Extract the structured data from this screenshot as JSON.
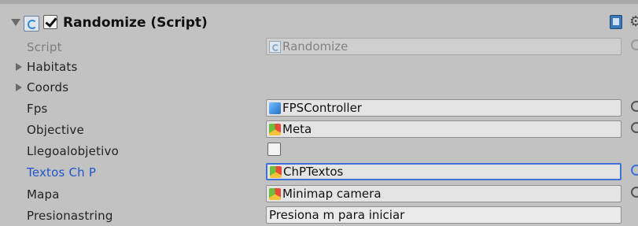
{
  "component": {
    "title": "Randomize (Script)",
    "enabled": true
  },
  "rows": {
    "script": {
      "label": "Script",
      "value": "Randomize",
      "icon": "script-icon"
    },
    "habitats": {
      "label": "Habitats"
    },
    "coords": {
      "label": "Coords"
    },
    "fps": {
      "label": "Fps",
      "value": "FPSController",
      "icon": "prefab-blue-cube-icon"
    },
    "objective": {
      "label": "Objective",
      "value": "Meta",
      "icon": "model-cube-icon"
    },
    "llegoalobjetivo": {
      "label": "Llegoalobjetivo",
      "checked": false
    },
    "textos": {
      "label": "Textos Ch P",
      "value": "ChPTextos",
      "icon": "model-cube-icon"
    },
    "mapa": {
      "label": "Mapa",
      "value": "Minimap camera",
      "icon": "model-cube-icon"
    },
    "presionastring": {
      "label": "Presionastring",
      "value": "Presiona m para iniciar"
    }
  },
  "colors": {
    "background": "#c2c2c2",
    "focus": "#3d72d8",
    "focused_label": "#1f56c9"
  }
}
